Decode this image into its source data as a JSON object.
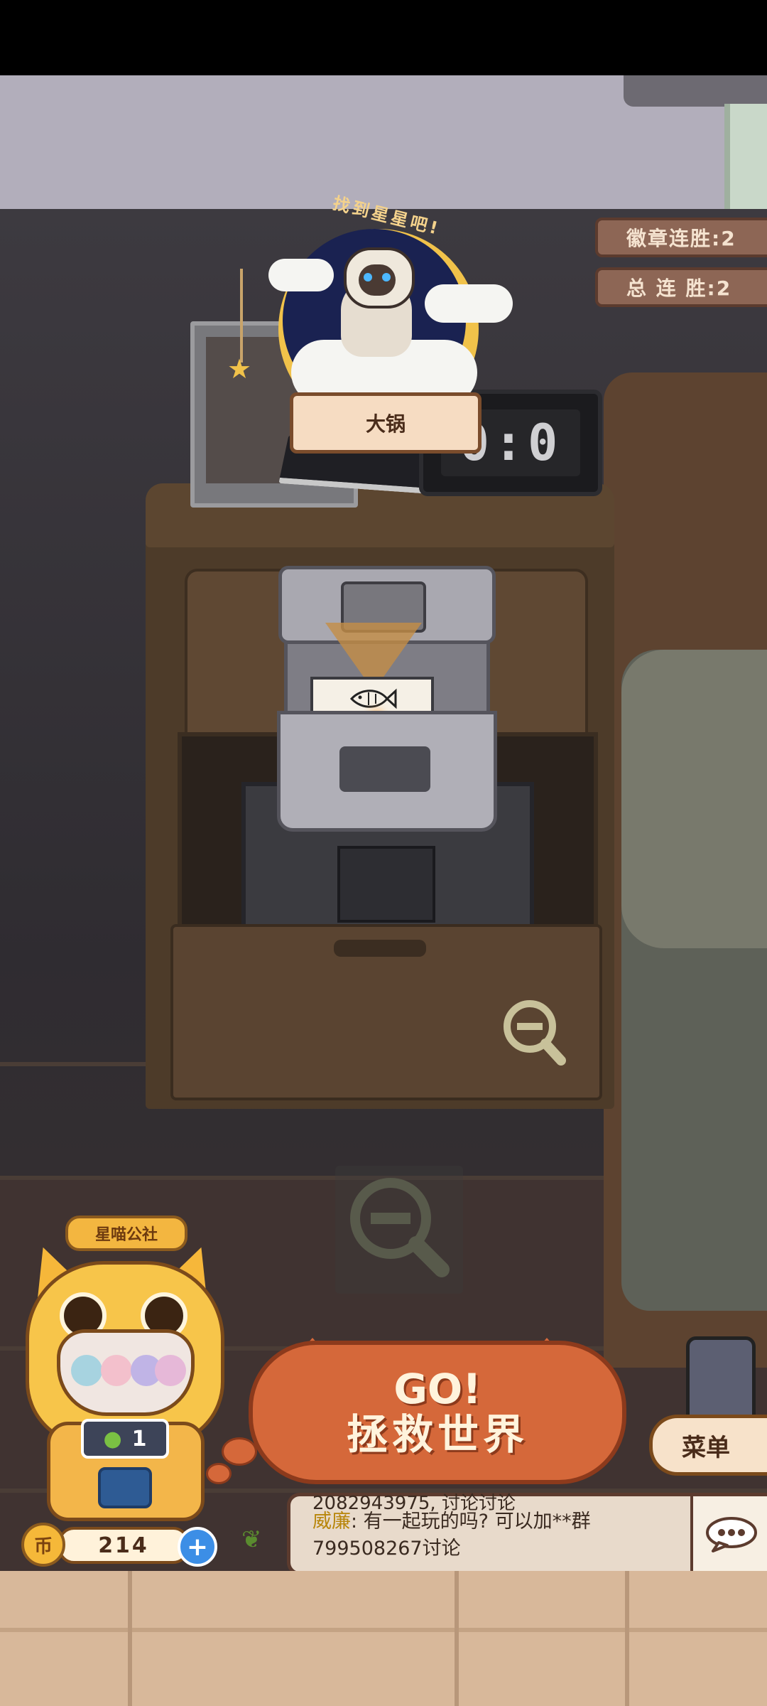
{
  "header_badge": {
    "title": "找到星星吧!",
    "player_name": "大锅"
  },
  "streaks": {
    "badge_streak": "徽章连胜:2",
    "total_streak": "总 连 胜:2"
  },
  "clock": {
    "display": "0:0"
  },
  "gashapon": {
    "label": "星喵公社",
    "bean_count": "1"
  },
  "currency": {
    "coin_icon_glyph": "币",
    "coins": "214",
    "add_glyph": "+"
  },
  "go_button": {
    "line1": "GO!",
    "line2": "拯救世界"
  },
  "menu": {
    "label": "菜单"
  },
  "chat": {
    "previous_line": "2082943975, 讨论讨论",
    "user": "威廉",
    "message": ": 有一起玩的吗? 可以加**群799508267讨论",
    "button_icon": "chat-bubble-icon"
  },
  "colors": {
    "go_orange": "#d5683a",
    "gashapon_yellow": "#f7c54a",
    "sign_brown": "#8d6655"
  }
}
